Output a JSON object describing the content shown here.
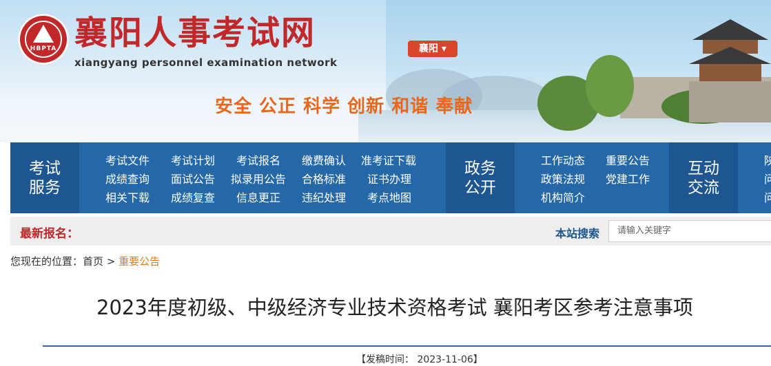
{
  "header": {
    "logo_abbr": "HBPTA",
    "site_title": "襄阳人事考试网",
    "site_subtitle": "xiangyang personnel examination network",
    "city_button": "襄阳 ▾",
    "slogan": "安全 公正 科学 创新 和谐 奉献"
  },
  "nav": {
    "groups": [
      {
        "label_line1": "考试",
        "label_line2": "服务",
        "items": [
          [
            "考试文件",
            "成绩查询",
            "相关下载"
          ],
          [
            "考试计划",
            "面试公告",
            "成绩复查"
          ],
          [
            "考试报名",
            "拟录用公告",
            "信息更正"
          ],
          [
            "缴费确认",
            "合格标准",
            "违纪处理"
          ],
          [
            "准考证下载",
            "证书办理",
            "考点地图"
          ]
        ]
      },
      {
        "label_line1": "政务",
        "label_line2": "公开",
        "items": [
          [
            "工作动态",
            "政策法规",
            "机构简介"
          ],
          [
            "重要公告",
            "党建工作"
          ]
        ]
      },
      {
        "label_line1": "互动",
        "label_line2": "交流",
        "items": [
          [
            "陕",
            "问",
            "问"
          ]
        ]
      }
    ]
  },
  "infobar": {
    "latest_label": "最新报名：",
    "search_label": "本站搜索",
    "search_placeholder": "请输入关键字"
  },
  "breadcrumb": {
    "prefix": "您现在的位置：",
    "home": "首页",
    "sep": ">",
    "current": "重要公告"
  },
  "article": {
    "title": "2023年度初级、中级经济专业技术资格考试 襄阳考区参考注意事项",
    "pubdate": "【发稿时间： 2023-11-06】"
  }
}
